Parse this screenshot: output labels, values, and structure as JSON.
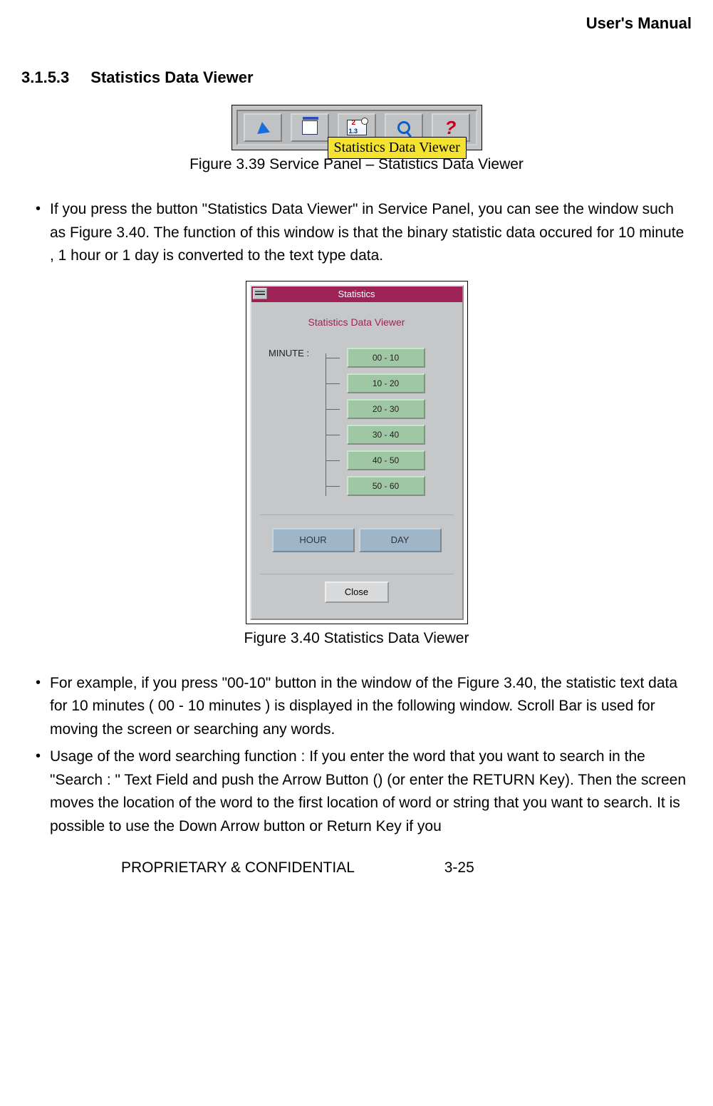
{
  "header": {
    "title": "User's Manual"
  },
  "section": {
    "number": "3.1.5.3",
    "title": "Statistics Data Viewer"
  },
  "fig39": {
    "tooltip": "Statistics Data Viewer",
    "caption": "Figure 3.39 Service Panel – Statistics Data Viewer"
  },
  "para1": "If you press the button \"Statistics Data Viewer\" in Service Panel, you can see the window such as Figure 3.40. The function of this window is that the binary statistic data occured for 10 minute , 1 hour or 1 day is converted to the text type data.",
  "fig40": {
    "win_title": "Statistics",
    "subtitle": "Statistics Data Viewer",
    "minute_label": "MINUTE :",
    "minute_buttons": [
      "00 - 10",
      "10 - 20",
      "20 - 30",
      "30 - 40",
      "40 - 50",
      "50 - 60"
    ],
    "hour_btn": "HOUR",
    "day_btn": "DAY",
    "close_btn": "Close",
    "caption": "Figure 3.40 Statistics Data Viewer"
  },
  "para2": "For example, if you press \"00-10\" button in the window of the Figure 3.40, the statistic text data for 10 minutes ( 00 - 10 minutes ) is displayed in the following window. Scroll Bar is used for moving the screen or searching any words.",
  "para3": "Usage of the word searching function : If you enter the word that you want to search in the \"Search : \" Text Field and push the Arrow Button () (or enter the RETURN Key). Then the screen moves the location of the word to the first location of word or string that you want to search. It is possible to use the Down Arrow button or Return Key if you",
  "footer": {
    "left": "PROPRIETARY & CONFIDENTIAL",
    "right": "3-25"
  }
}
